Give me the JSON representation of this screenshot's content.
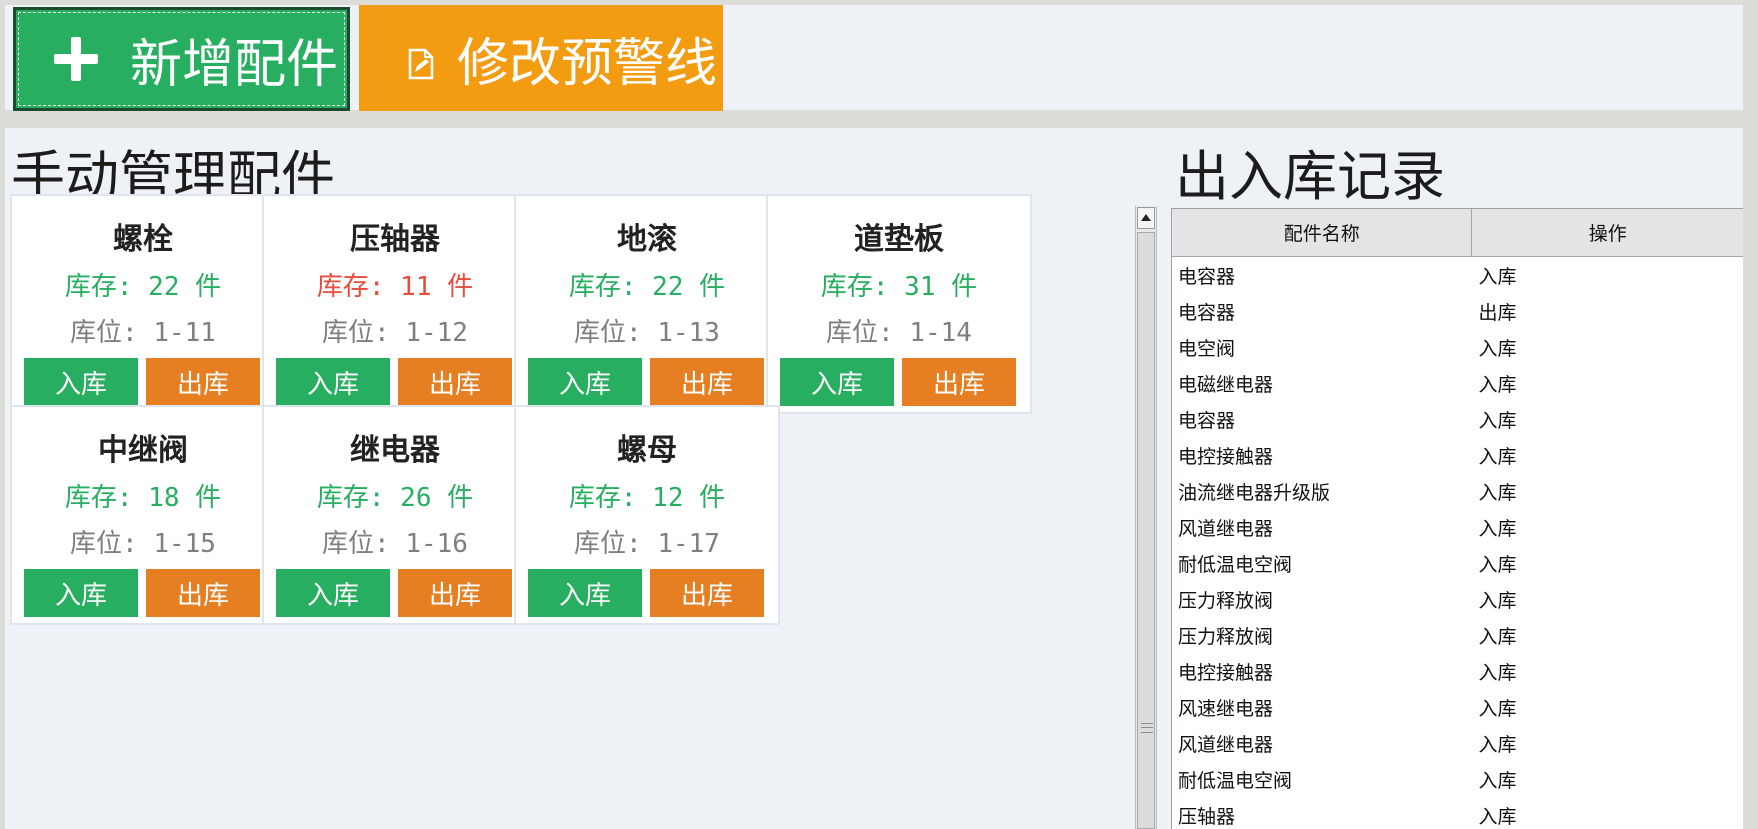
{
  "toolbar": {
    "add_label": "新增配件",
    "edit_label": "修改预警线"
  },
  "left_panel": {
    "title": "手动管理配件",
    "cards": [
      {
        "name": "螺栓",
        "stock": "库存: 22 件",
        "location": "库位: 1-11",
        "in_label": "入库",
        "out_label": "出库"
      },
      {
        "name": "压轴器",
        "stock": "库存: 11 件",
        "location": "库位: 1-12",
        "in_label": "入库",
        "out_label": "出库"
      },
      {
        "name": "地滚",
        "stock": "库存: 22 件",
        "location": "库位: 1-13",
        "in_label": "入库",
        "out_label": "出库"
      },
      {
        "name": "道垫板",
        "stock": "库存: 31 件",
        "location": "库位: 1-14",
        "in_label": "入库",
        "out_label": "出库"
      },
      {
        "name": "中继阀",
        "stock": "库存: 18 件",
        "location": "库位: 1-15",
        "in_label": "入库",
        "out_label": "出库"
      },
      {
        "name": "继电器",
        "stock": "库存: 26 件",
        "location": "库位: 1-16",
        "in_label": "入库",
        "out_label": "出库"
      },
      {
        "name": "螺母",
        "stock": "库存: 12 件",
        "location": "库位: 1-17",
        "in_label": "入库",
        "out_label": "出库"
      }
    ]
  },
  "records": {
    "title": "出入库记录",
    "columns": [
      "配件名称",
      "操作"
    ],
    "rows": [
      [
        "电容器",
        "入库"
      ],
      [
        "电容器",
        "出库"
      ],
      [
        "电空阀",
        "入库"
      ],
      [
        "电磁继电器",
        "入库"
      ],
      [
        "电容器",
        "入库"
      ],
      [
        "电控接触器",
        "入库"
      ],
      [
        "油流继电器升级版",
        "入库"
      ],
      [
        "风道继电器",
        "入库"
      ],
      [
        "耐低温电空阀",
        "入库"
      ],
      [
        "压力释放阀",
        "入库"
      ],
      [
        "压力释放阀",
        "入库"
      ],
      [
        "电控接触器",
        "入库"
      ],
      [
        "风速继电器",
        "入库"
      ],
      [
        "风道继电器",
        "入库"
      ],
      [
        "耐低温电空阀",
        "入库"
      ],
      [
        "压轴器",
        "入库"
      ]
    ]
  },
  "colors": {
    "stock_ok": "#27ae60",
    "stock_low": "#e74c3c",
    "in_button": "#27ae60",
    "out_button": "#e67e22",
    "edit_button": "#f39c12"
  }
}
